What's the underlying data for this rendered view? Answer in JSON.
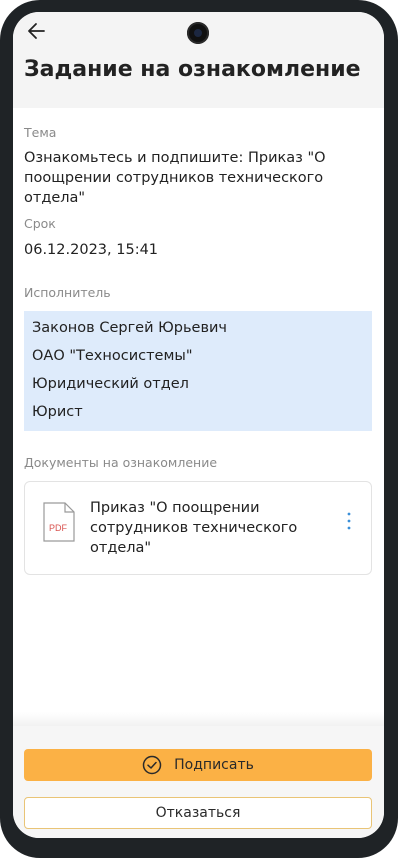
{
  "header": {
    "title": "Задание на ознакомление"
  },
  "topic": {
    "label": "Тема",
    "value": "Ознакомьтесь и подпишите: Приказ \"О поощрении сотрудников технического отдела\""
  },
  "deadline": {
    "label": "Срок",
    "value": "06.12.2023, 15:41"
  },
  "executor": {
    "label": "Исполнитель",
    "lines": [
      "Законов Сергей Юрьевич",
      "ОАО \"Техносистемы\"",
      "Юридический отдел",
      "Юрист"
    ]
  },
  "documents": {
    "label": "Документы на ознакомление",
    "items": [
      {
        "icon": "pdf-file-icon",
        "badge": "PDF",
        "name": "Приказ \"О поощрении сотрудников технического отдела\""
      }
    ]
  },
  "actions": {
    "sign_label": "Подписать",
    "decline_label": "Отказаться"
  },
  "colors": {
    "accent": "#fbb145",
    "executor_bg": "#deebfb",
    "pdf_red": "#d9534f",
    "menu_blue": "#3a8fd8"
  }
}
